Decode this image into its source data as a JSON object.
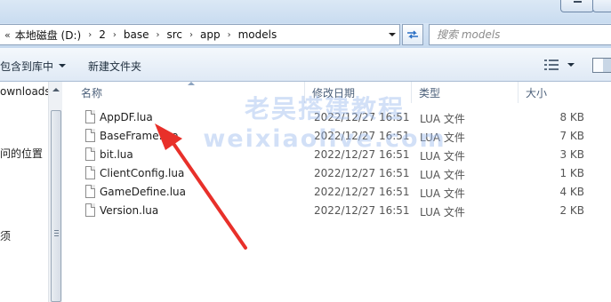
{
  "window": {
    "minimize_icon": "minimize-icon",
    "close_icon": "close-icon"
  },
  "address_bar": {
    "start_glyph": "«",
    "crumbs": [
      "本地磁盘 (D:)",
      "2",
      "base",
      "src",
      "app",
      "models"
    ],
    "separator": "›",
    "dropdown_icon": "chevron-down-icon",
    "refresh_icon": "refresh-icon"
  },
  "search": {
    "placeholder": "搜索 models"
  },
  "toolbar": {
    "include_label": "包含到库中",
    "new_folder_label": "新建文件夹",
    "view_icon": "details-view-icon",
    "pane_icon": "preview-pane-icon"
  },
  "nav": {
    "items": [
      "ownloads",
      "问的位置",
      "须"
    ]
  },
  "columns": {
    "name": "名称",
    "date": "修改日期",
    "type": "类型",
    "size": "大小"
  },
  "files": [
    {
      "name": "AppDF.lua",
      "date": "2022/12/27 16:51",
      "type": "LUA 文件",
      "size": "8 KB"
    },
    {
      "name": "BaseFrame.lua",
      "date": "2022/12/27 16:51",
      "type": "LUA 文件",
      "size": "7 KB"
    },
    {
      "name": "bit.lua",
      "date": "2022/12/27 16:51",
      "type": "LUA 文件",
      "size": "3 KB"
    },
    {
      "name": "ClientConfig.lua",
      "date": "2022/12/27 16:51",
      "type": "LUA 文件",
      "size": "1 KB"
    },
    {
      "name": "GameDefine.lua",
      "date": "2022/12/27 16:51",
      "type": "LUA 文件",
      "size": "4 KB"
    },
    {
      "name": "Version.lua",
      "date": "2022/12/27 16:51",
      "type": "LUA 文件",
      "size": "2 KB"
    }
  ],
  "watermark": {
    "line1": "老吴搭建教程",
    "line2": "weixiaolive.com"
  },
  "colors": {
    "annotation_arrow": "#e8302a",
    "watermark": "#9cbaee"
  }
}
